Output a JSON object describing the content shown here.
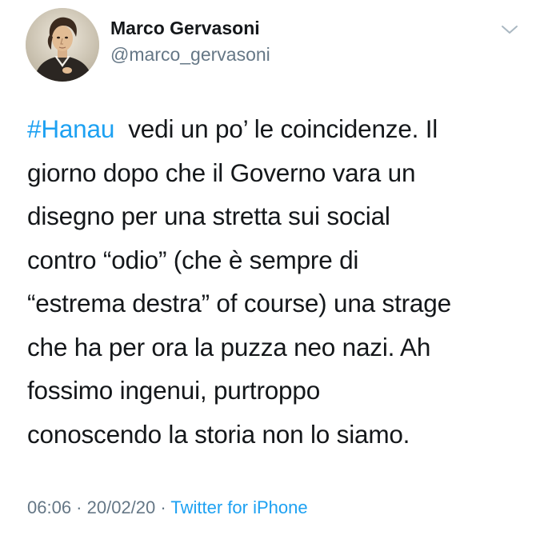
{
  "author": {
    "display_name": "Marco Gervasoni",
    "handle": "@marco_gervasoni"
  },
  "tweet": {
    "hashtag": "#Hanau",
    "line1_rest": "  vedi un po’ le coincidenze. Il",
    "line2": "giorno dopo che il Governo vara un",
    "line3": "disegno per una stretta sui social",
    "line4": "contro “odio” (che è sempre di",
    "line5": "“estrema destra” of course) una strage",
    "line6": "che ha per ora la puzza neo nazi. Ah",
    "line7": "fossimo ingenui, purtroppo",
    "line8": "conoscendo la storia non lo siamo."
  },
  "meta": {
    "time": "06:06",
    "separator1": " · ",
    "date": "20/02/20",
    "separator2": " · ",
    "source": "Twitter for iPhone"
  },
  "icons": {
    "avatar": "avatar-portrait",
    "menu": "chevron-down-icon"
  },
  "colors": {
    "link": "#1da1f2",
    "secondary": "#657786",
    "text": "#14171a"
  }
}
